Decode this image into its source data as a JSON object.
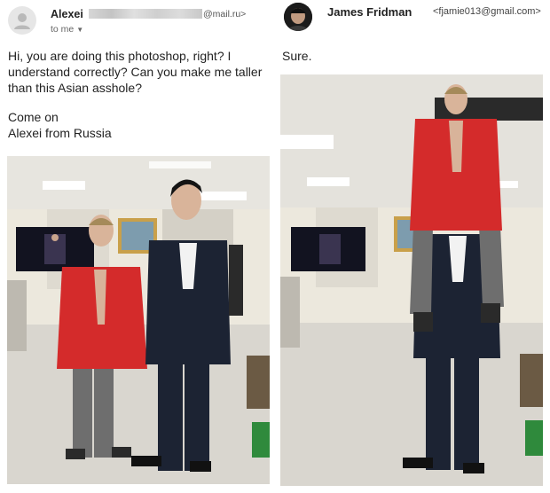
{
  "left_email": {
    "sender_name": "Alexei",
    "sender_address_suffix": "@mail.ru>",
    "recipient_line": "to me",
    "avatar_icon": "person-icon",
    "body_paragraph_1": "Hi, you are doing this photoshop, right? I understand correctly? Can you make me taller than this Asian asshole?",
    "body_paragraph_2_line_1": "Come on",
    "body_paragraph_2_line_2": "Alexei from Russia",
    "attachment": "photo of two men standing side by side in a room"
  },
  "right_email": {
    "sender_name": "James Fridman",
    "sender_address": "<fjamie013@gmail.com>",
    "body": "Sure.",
    "attachment": "edited photo with the shorter man sitting on the taller man's shoulders"
  },
  "colors": {
    "red_jacket": "#d42b2b",
    "navy_suit": "#1c2333",
    "grey_pants": "#6e6e6e",
    "floor": "#d9d6cf",
    "ceiling": "#e7e5df"
  }
}
